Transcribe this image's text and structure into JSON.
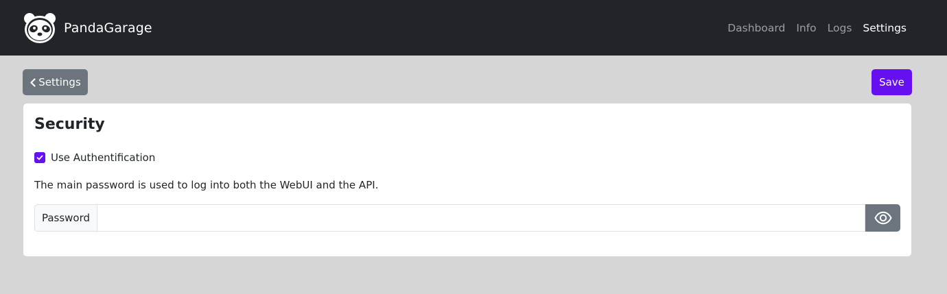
{
  "app": {
    "brand_name": "PandaGarage",
    "logo_icon": "panda-logo-icon"
  },
  "nav": {
    "items": [
      {
        "label": "Dashboard",
        "active": false
      },
      {
        "label": "Info",
        "active": false
      },
      {
        "label": "Logs",
        "active": false
      },
      {
        "label": "Settings",
        "active": true
      }
    ]
  },
  "toolbar": {
    "back_label": "Settings",
    "back_icon": "chevron-left-icon",
    "save_label": "Save"
  },
  "security": {
    "title": "Security",
    "use_auth_label": "Use Authentification",
    "use_auth_checked": true,
    "help_text": "The main password is used to log into both the WebUI and the API.",
    "password_label": "Password",
    "password_value": "",
    "reveal_icon": "eye-icon"
  },
  "colors": {
    "navbar_bg": "#212529",
    "page_bg": "#d6d6d6",
    "accent": "#6610f2",
    "secondary": "#6c757d"
  }
}
